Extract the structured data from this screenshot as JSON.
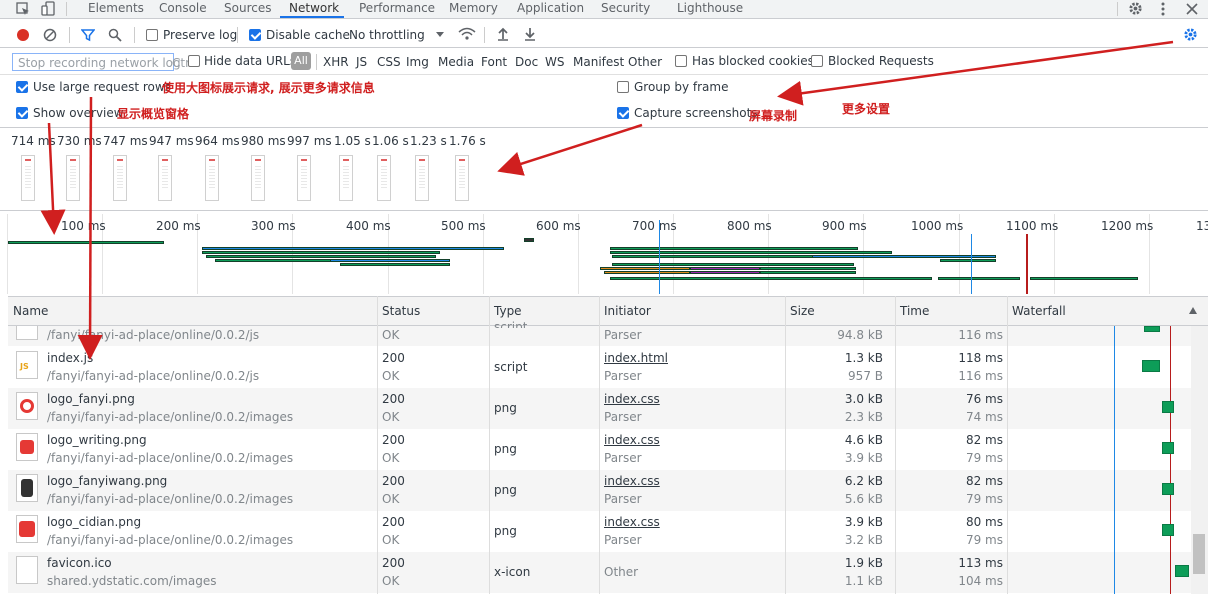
{
  "tabs": [
    "Elements",
    "Console",
    "Sources",
    "Network",
    "Performance",
    "Memory",
    "Application",
    "Security",
    "Lighthouse"
  ],
  "toolbar": {
    "preserve_log": "Preserve log",
    "disable_cache": "Disable cache",
    "throttling": "No throttling"
  },
  "filter": {
    "placeholder": "Stop recording network log",
    "shortcut": "Ctrl",
    "hide_data_urls": "Hide data URLs",
    "all": "All",
    "types": [
      "XHR",
      "JS",
      "CSS",
      "Img",
      "Media",
      "Font",
      "Doc",
      "WS",
      "Manifest",
      "Other"
    ],
    "has_blocked_cookies": "Has blocked cookies",
    "blocked_requests": "Blocked Requests"
  },
  "settings": {
    "large_rows": "Use large request rows",
    "large_rows_note": "使用大图标展示请求, 展示更多请求信息",
    "show_overview": "Show overview",
    "show_overview_note": "显示概览窗格",
    "group_by_frame": "Group by frame",
    "capture_screenshots": "Capture screenshots",
    "capture_note": "屏幕录制",
    "more_settings_note": "更多设置"
  },
  "screenshots": [
    "714 ms",
    "730 ms",
    "747 ms",
    "947 ms",
    "964 ms",
    "980 ms",
    "997 ms",
    "1.05 s",
    "1.06 s",
    "1.23 s",
    "1.76 s"
  ],
  "timeline_ticks": [
    "100 ms",
    "200 ms",
    "300 ms",
    "400 ms",
    "500 ms",
    "600 ms",
    "700 ms",
    "800 ms",
    "900 ms",
    "1000 ms",
    "1100 ms",
    "1200 ms",
    "13"
  ],
  "columns": [
    "Name",
    "Status",
    "Type",
    "Initiator",
    "Size",
    "Time",
    "Waterfall"
  ],
  "partial_row": {
    "path": "/fanyi/fanyi-ad-place/online/0.0.2/js",
    "status": "OK",
    "type": "script",
    "initiator": "Parser",
    "size": "94.8 kB",
    "time": "116 ms"
  },
  "rows": [
    {
      "name": "index.js",
      "path": "/fanyi/fanyi-ad-place/online/0.0.2/js",
      "status": "200",
      "status2": "OK",
      "type": "script",
      "initiator": "index.html",
      "initiator2": "Parser",
      "size": "1.3 kB",
      "size2": "957 B",
      "time": "118 ms",
      "time2": "116 ms"
    },
    {
      "name": "logo_fanyi.png",
      "path": "/fanyi/fanyi-ad-place/online/0.0.2/images",
      "status": "200",
      "status2": "OK",
      "type": "png",
      "initiator": "index.css",
      "initiator2": "Parser",
      "size": "3.0 kB",
      "size2": "2.3 kB",
      "time": "76 ms",
      "time2": "74 ms"
    },
    {
      "name": "logo_writing.png",
      "path": "/fanyi/fanyi-ad-place/online/0.0.2/images",
      "status": "200",
      "status2": "OK",
      "type": "png",
      "initiator": "index.css",
      "initiator2": "Parser",
      "size": "4.6 kB",
      "size2": "3.9 kB",
      "time": "82 ms",
      "time2": "79 ms"
    },
    {
      "name": "logo_fanyiwang.png",
      "path": "/fanyi/fanyi-ad-place/online/0.0.2/images",
      "status": "200",
      "status2": "OK",
      "type": "png",
      "initiator": "index.css",
      "initiator2": "Parser",
      "size": "6.2 kB",
      "size2": "5.6 kB",
      "time": "82 ms",
      "time2": "79 ms"
    },
    {
      "name": "logo_cidian.png",
      "path": "/fanyi/fanyi-ad-place/online/0.0.2/images",
      "status": "200",
      "status2": "OK",
      "type": "png",
      "initiator": "index.css",
      "initiator2": "Parser",
      "size": "3.9 kB",
      "size2": "3.2 kB",
      "time": "80 ms",
      "time2": "79 ms"
    },
    {
      "name": "favicon.ico",
      "path": "shared.ydstatic.com/images",
      "status": "200",
      "status2": "OK",
      "type": "x-icon",
      "initiator": "Other",
      "initiator2": "",
      "size": "1.9 kB",
      "size2": "1.1 kB",
      "time": "113 ms",
      "time2": "104 ms"
    }
  ],
  "colors": {
    "accent": "#1a73e8",
    "record": "#d93025",
    "annotation": "#d01f1f",
    "waterfall_green": "#0d9d58"
  }
}
